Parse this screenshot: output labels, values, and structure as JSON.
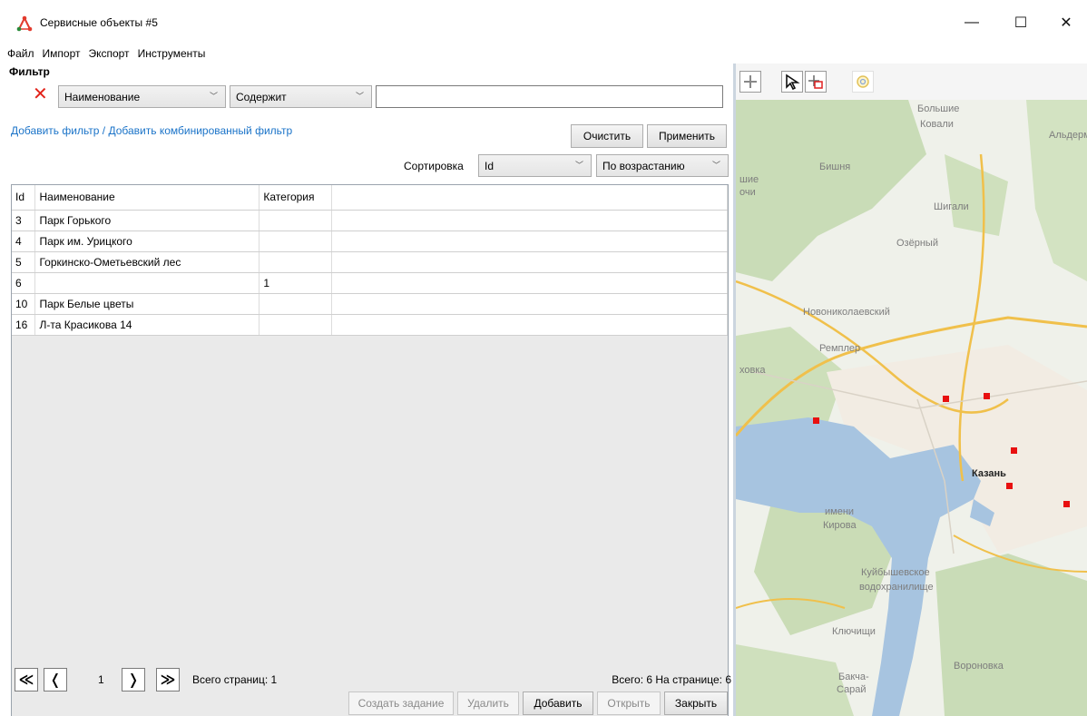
{
  "window": {
    "title": "Сервисные объекты #5",
    "minimize_glyph": "—",
    "maximize_glyph": "☐",
    "close_glyph": "✕"
  },
  "menu": [
    "Файл",
    "Импорт",
    "Экспорт",
    "Инструменты"
  ],
  "filter": {
    "title": "Фильтр",
    "field": "Наименование",
    "condition": "Содержит",
    "value": "",
    "add_filter": "Добавить фильтр",
    "separator": "/",
    "add_combined": "Добавить комбинированный фильтр",
    "clear": "Очистить",
    "apply": "Применить"
  },
  "sort": {
    "label": "Сортировка",
    "field": "Id",
    "order": "По возрастанию"
  },
  "grid": {
    "columns": [
      "Id",
      "Наименование",
      "Категория"
    ],
    "rows": [
      [
        "3",
        "Парк Горького",
        ""
      ],
      [
        "4",
        "Парк им. Урицкого",
        ""
      ],
      [
        "5",
        "Горкинско-Ометьевский лес",
        ""
      ],
      [
        "6",
        "",
        "1"
      ],
      [
        "10",
        "Парк Белые цветы",
        ""
      ],
      [
        "16",
        "Л-та Красикова 14",
        ""
      ]
    ]
  },
  "pager": {
    "first": "≪",
    "prev": "❬",
    "page": "1",
    "next": "❭",
    "last": "≫",
    "total_pages": "Всего страниц: 1",
    "total_info": "Всего: 6   На странице: 6"
  },
  "actions": {
    "create_task": "Создать задание",
    "delete": "Удалить",
    "add": "Добавить",
    "open": "Открыть",
    "close": "Закрыть"
  },
  "map": {
    "labels": [
      "Большие",
      "Ковали",
      "Альдерм",
      "Бишня",
      "шие",
      "очи",
      "Шигали",
      "Озёрный",
      "Новониколаевский",
      "Ремплер",
      "ховка",
      "Казань",
      "имени",
      "Кирова",
      "Куйбышевское",
      "водохранилище",
      "Ключищи",
      "Вороновка",
      "Бакча-",
      "Сарай"
    ],
    "marker_color": "#e81010"
  }
}
